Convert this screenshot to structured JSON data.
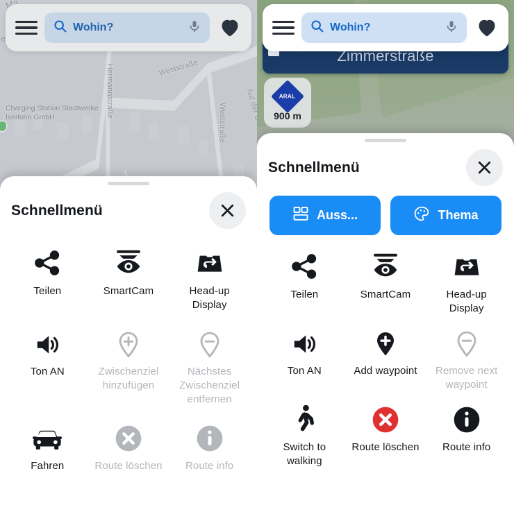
{
  "left": {
    "search": {
      "menu_icon": "hamburger-icon",
      "search_icon": "search-icon",
      "placeholder": "Wohin?",
      "mic_icon": "microphone-icon",
      "favorites_icon": "heart-icon"
    },
    "map": {
      "street_labels": [
        "Hermannstraße",
        "Weststraße",
        "Weststraße",
        "Auf der B",
        "Ma",
        "e"
      ],
      "poi": "Charging Station Stadtwerke Iserlohn GmbH"
    },
    "sheet": {
      "title": "Schnellmenü",
      "close_icon": "close-icon",
      "items": [
        {
          "icon": "share-icon",
          "label": "Teilen",
          "disabled": false
        },
        {
          "icon": "smartcam-icon",
          "label": "SmartCam",
          "disabled": false
        },
        {
          "icon": "head-up-display-icon",
          "label": "Head-up Display",
          "disabled": false
        },
        {
          "icon": "volume-on-icon",
          "label": "Ton AN",
          "disabled": false
        },
        {
          "icon": "add-waypoint-icon",
          "label": "Zwischenziel hinzufügen",
          "disabled": true
        },
        {
          "icon": "remove-waypoint-icon",
          "label": "Nächstes Zwischenziel entfernen",
          "disabled": true
        },
        {
          "icon": "car-icon",
          "label": "Fahren",
          "disabled": false
        },
        {
          "icon": "cancel-route-icon",
          "label": "Route löschen",
          "disabled": true
        },
        {
          "icon": "info-icon",
          "label": "Route info",
          "disabled": true
        }
      ]
    }
  },
  "right": {
    "search": {
      "menu_icon": "hamburger-icon",
      "search_icon": "search-icon",
      "placeholder": "Wohin?",
      "mic_icon": "microphone-icon",
      "favorites_icon": "heart-icon"
    },
    "nav_banner": {
      "street": "Zimmerstraße"
    },
    "fuel_badge": {
      "brand": "ARAL",
      "distance": "900 m"
    },
    "sheet": {
      "title": "Schnellmenü",
      "close_icon": "close-icon",
      "actions": [
        {
          "icon": "layout-icon",
          "label": "Auss..."
        },
        {
          "icon": "palette-icon",
          "label": "Thema"
        }
      ],
      "items": [
        {
          "icon": "share-icon",
          "label": "Teilen",
          "disabled": false
        },
        {
          "icon": "smartcam-icon",
          "label": "SmartCam",
          "disabled": false
        },
        {
          "icon": "head-up-display-icon",
          "label": "Head-up Display",
          "disabled": false
        },
        {
          "icon": "volume-on-icon",
          "label": "Ton AN",
          "disabled": false
        },
        {
          "icon": "add-waypoint-icon",
          "label": "Add waypoint",
          "disabled": false
        },
        {
          "icon": "remove-waypoint-icon",
          "label": "Remove next waypoint",
          "disabled": true
        },
        {
          "icon": "walking-icon",
          "label": "Switch to walking",
          "disabled": false
        },
        {
          "icon": "cancel-route-icon",
          "label": "Route löschen",
          "disabled": false
        },
        {
          "icon": "info-icon",
          "label": "Route info",
          "disabled": false
        }
      ]
    }
  },
  "colors": {
    "accent_blue": "#1a8cf5",
    "search_text_blue": "#1569c7",
    "search_field_bg": "#cfe0f4",
    "banner_navy": "#16355e",
    "aral_blue": "#1a3da8",
    "danger_red": "#e03131",
    "dark": "#15181c",
    "disabled_grey": "#b3b6ba"
  }
}
